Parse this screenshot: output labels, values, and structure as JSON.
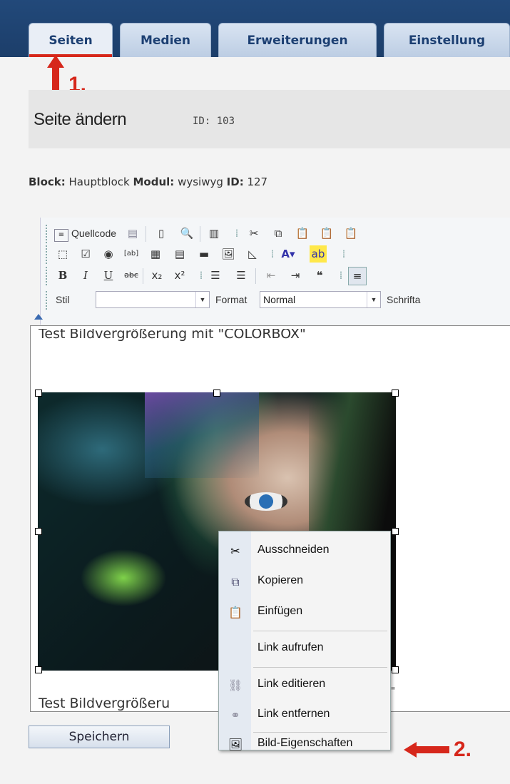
{
  "nav": {
    "tabs": [
      {
        "label": "Seiten",
        "active": true
      },
      {
        "label": "Medien"
      },
      {
        "label": "Erweiterungen"
      },
      {
        "label": "Einstellung"
      }
    ]
  },
  "annotations": {
    "step1": "1.",
    "step2": "2."
  },
  "header": {
    "title": "Seite ändern",
    "id_text": "ID: 103"
  },
  "block_info": {
    "block_label": "Block:",
    "block_value": "Hauptblock",
    "module_label": "Modul:",
    "module_value": "wysiwyg",
    "id_label": "ID:",
    "id_value": "127"
  },
  "toolbar": {
    "source_label": "Quellcode",
    "style_label": "Stil",
    "style_value": "",
    "format_label": "Format",
    "format_value": "Normal",
    "font_label": "Schrifta"
  },
  "editor": {
    "line1": "Test Bildvergrößerung mit \"COLORBOX\"",
    "line2": "Test Bildvergrößeru"
  },
  "context_menu": {
    "items": [
      {
        "label": "Ausschneiden",
        "icon": "scissors-icon"
      },
      {
        "label": "Kopieren",
        "icon": "copy-icon"
      },
      {
        "label": "Einfügen",
        "icon": "paste-icon"
      },
      {
        "label": "Link aufrufen",
        "icon": ""
      },
      {
        "label": "Link editieren",
        "icon": "link-icon"
      },
      {
        "label": "Link entfernen",
        "icon": "unlink-icon"
      },
      {
        "label": "Bild-Eigenschaften",
        "icon": "image-properties-icon"
      }
    ]
  },
  "save_button": "Speichern",
  "colors": {
    "nav_bg": "#1c3e6a",
    "annotation": "#d6271b"
  }
}
